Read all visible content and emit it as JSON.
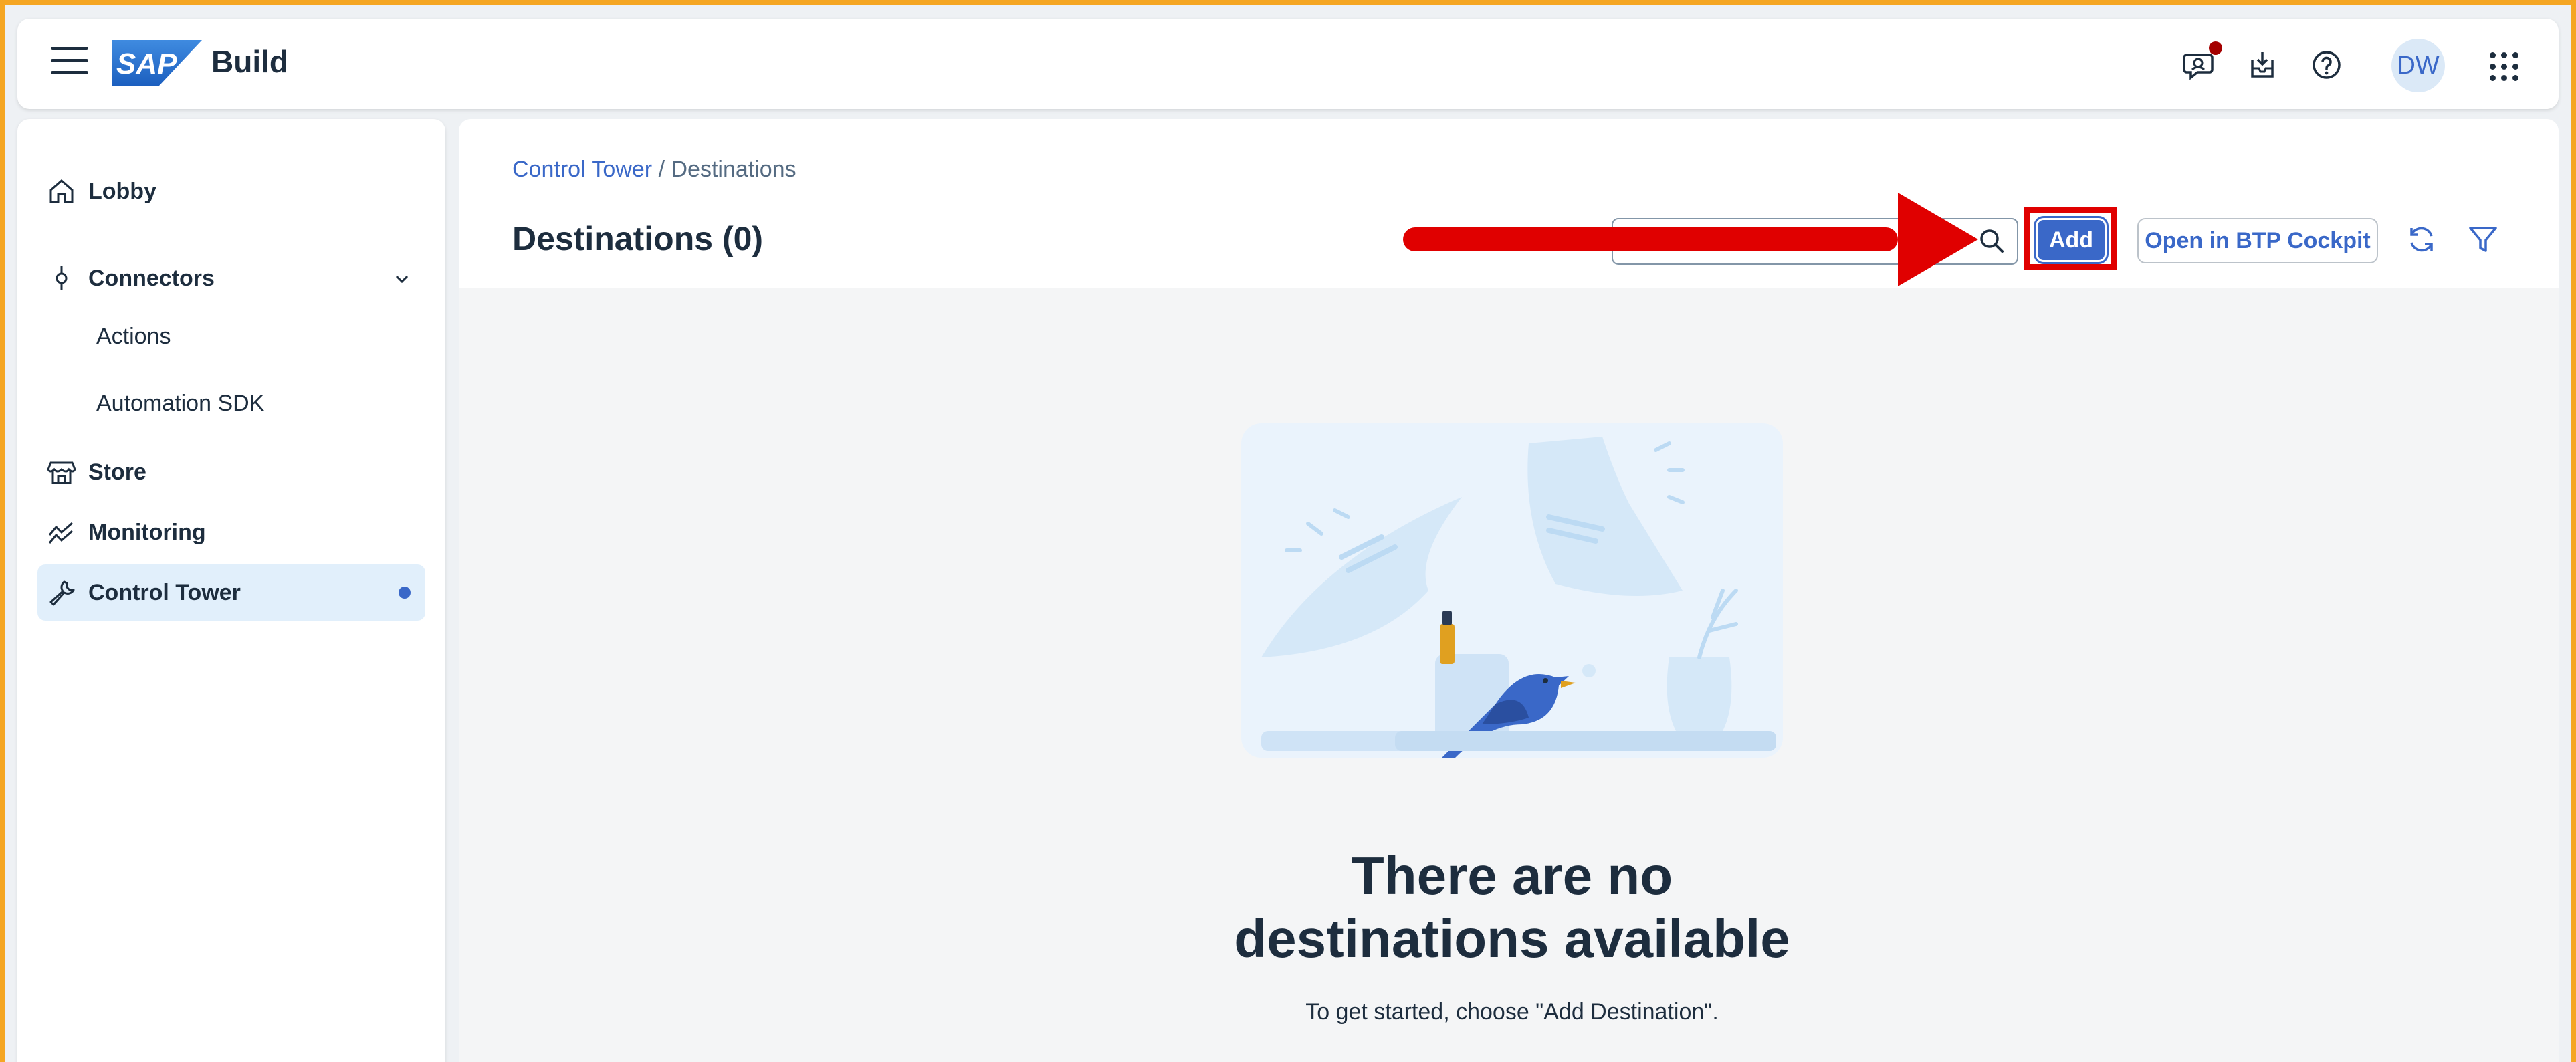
{
  "shell": {
    "brand_logo_text": "SAP",
    "brand_name": "Build",
    "avatar_initials": "DW",
    "icons": [
      "menu-icon",
      "feedback-icon",
      "download-icon",
      "help-icon",
      "app-grid-icon"
    ]
  },
  "sidebar": {
    "items": [
      {
        "label": "Lobby",
        "icon": "home-icon"
      },
      {
        "label": "Connectors",
        "icon": "connector-icon",
        "expanded": true
      },
      {
        "label": "Actions"
      },
      {
        "label": "Automation SDK"
      },
      {
        "label": "Store",
        "icon": "store-icon"
      },
      {
        "label": "Monitoring",
        "icon": "trend-icon"
      },
      {
        "label": "Control Tower",
        "icon": "wrench-icon",
        "active": true
      }
    ]
  },
  "main": {
    "breadcrumb": {
      "parent": "Control Tower",
      "separator": " / ",
      "current": "Destinations"
    },
    "title": "Destinations (0)",
    "search": {
      "placeholder": ""
    },
    "add_label": "Add",
    "btp_label": "Open in BTP Cockpit",
    "empty": {
      "title": "There are no destinations available",
      "subtitle": "To get started, choose \"Add Destination\"."
    }
  },
  "colors": {
    "accent": "#3a68c8",
    "annotation_red": "#e00000",
    "frame_border": "#f5a623",
    "active_bg": "#e1effb"
  }
}
